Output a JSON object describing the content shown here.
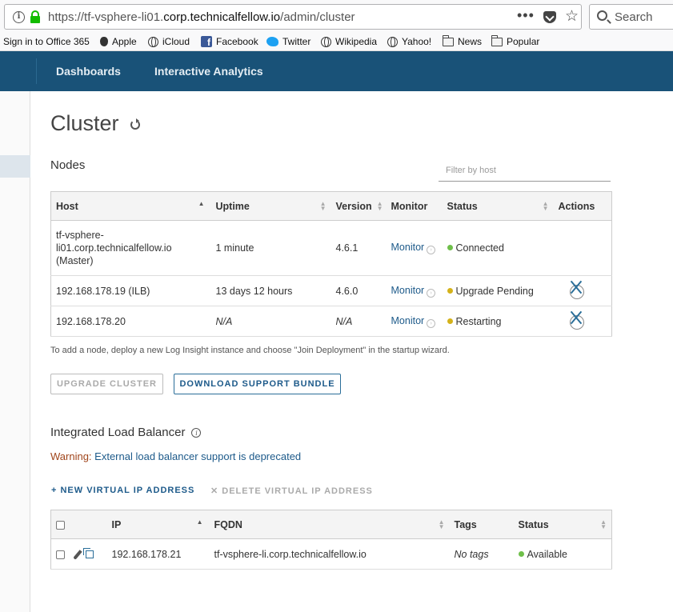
{
  "browser": {
    "url_prefix": "https://tf-vsphere-li01.",
    "url_host": "corp.technicalfellow.io",
    "url_path": "/admin/cluster",
    "more_glyph": "•••",
    "search_placeholder": "Search",
    "bookmarks": [
      {
        "label": "Sign in to Office 365",
        "icon": "none"
      },
      {
        "label": "Apple",
        "icon": "apple-icon"
      },
      {
        "label": "iCloud",
        "icon": "globe-icon"
      },
      {
        "label": "Facebook",
        "icon": "facebook-icon"
      },
      {
        "label": "Twitter",
        "icon": "twitter-icon"
      },
      {
        "label": "Wikipedia",
        "icon": "globe-icon"
      },
      {
        "label": "Yahoo!",
        "icon": "globe-icon"
      },
      {
        "label": "News",
        "icon": "folder-icon"
      },
      {
        "label": "Popular",
        "icon": "folder-icon"
      }
    ]
  },
  "nav": {
    "dashboards": "Dashboards",
    "interactive_analytics": "Interactive Analytics"
  },
  "page": {
    "title": "Cluster"
  },
  "nodes": {
    "title": "Nodes",
    "filter_placeholder": "Filter by host",
    "columns": {
      "host": "Host",
      "uptime": "Uptime",
      "version": "Version",
      "monitor": "Monitor",
      "status": "Status",
      "actions": "Actions"
    },
    "rows": [
      {
        "host": "tf-vsphere-li01.corp.technicalfellow.io (Master)",
        "host_line1": "tf-vsphere-",
        "host_line2": "li01.corp.technicalfellow.io",
        "host_line3": "(Master)",
        "uptime": "1 minute",
        "version": "4.6.1",
        "monitor": "Monitor",
        "status": "Connected",
        "status_color": "#6fbf4a"
      },
      {
        "host": "192.168.178.19 (ILB)",
        "uptime": "13 days 12 hours",
        "version": "4.6.0",
        "monitor": "Monitor",
        "status": "Upgrade Pending",
        "status_color": "#d4b21a"
      },
      {
        "host": "192.168.178.20",
        "uptime": "N/A",
        "version": "N/A",
        "monitor": "Monitor",
        "status": "Restarting",
        "status_color": "#d4b21a"
      }
    ],
    "hint": "To add a node, deploy a new Log Insight instance and choose \"Join Deployment\" in the startup wizard.",
    "upgrade_label": "UPGRADE CLUSTER",
    "download_label": "DOWNLOAD SUPPORT BUNDLE"
  },
  "ilb": {
    "title": "Integrated Load Balancer",
    "warning_label": "Warning:",
    "warning_link": "External load balancer support is deprecated",
    "new_vip": "+ NEW VIRTUAL IP ADDRESS",
    "delete_vip": "✕ DELETE VIRTUAL IP ADDRESS",
    "columns": {
      "ip": "IP",
      "fqdn": "FQDN",
      "tags": "Tags",
      "status": "Status"
    },
    "rows": [
      {
        "ip": "192.168.178.21",
        "fqdn": "tf-vsphere-li.corp.technicalfellow.io",
        "tags": "No tags",
        "status": "Available",
        "status_color": "#6fbf4a"
      }
    ]
  }
}
